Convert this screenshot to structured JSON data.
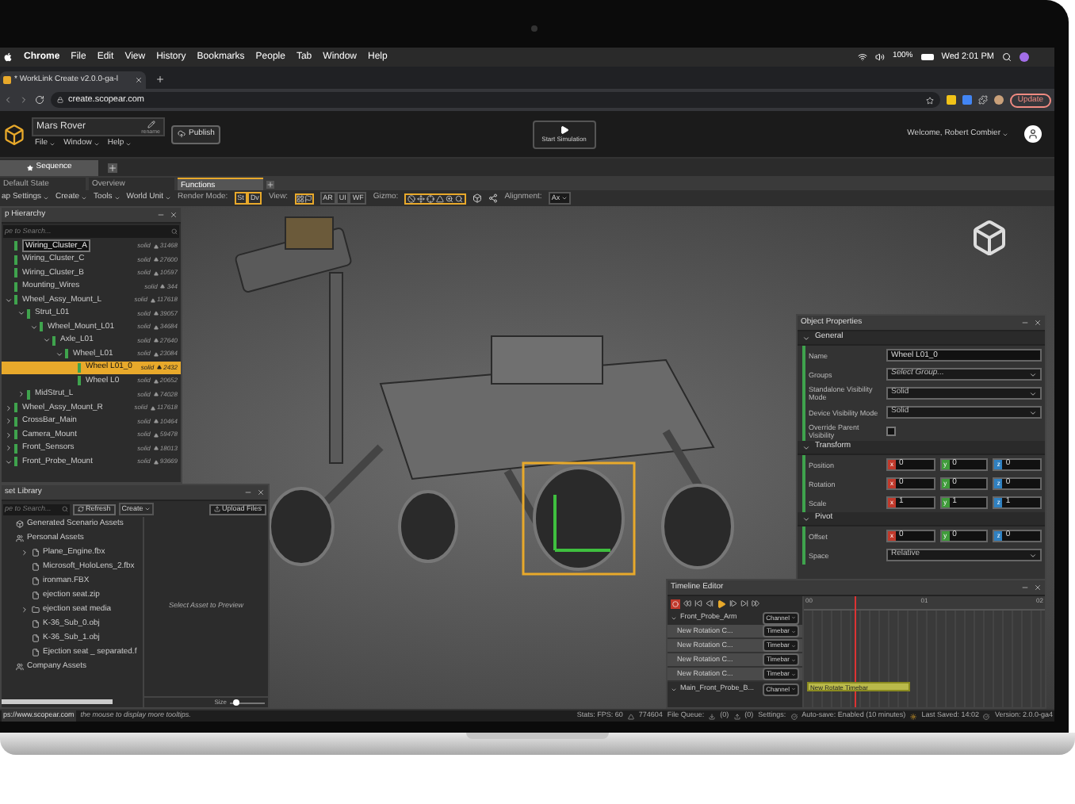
{
  "menu_bar": {
    "items": [
      "Chrome",
      "File",
      "Edit",
      "View",
      "History",
      "Bookmarks",
      "People",
      "Tab",
      "Window",
      "Help"
    ],
    "battery": "100%",
    "clock": "Wed 2:01 PM"
  },
  "browser": {
    "tab_title": "* WorkLink Create v2.0.0-ga-l",
    "url": "create.scopear.com",
    "update_button": "Update"
  },
  "app_header": {
    "project_name": "Mars Rover",
    "rename_label": "rename",
    "menus": [
      "File",
      "Window",
      "Help"
    ],
    "publish_button": "Publish",
    "simulation_button": "Start Simulation",
    "welcome": "Welcome, Robert Combier"
  },
  "sequence_tabs": [
    {
      "label": "Sequence",
      "selected": true
    }
  ],
  "state_tabs": [
    {
      "label": "Default State",
      "selected": false
    },
    {
      "label": "Overview",
      "selected": false
    },
    {
      "label": "Functions",
      "selected": true
    }
  ],
  "toolbar": {
    "menus": [
      "ap Settings",
      "Create",
      "Tools",
      "World Unit"
    ],
    "render_mode_label": "Render Mode:",
    "render_modes": [
      {
        "label": "St",
        "selected": true
      },
      {
        "label": "Dv",
        "selected": true
      }
    ],
    "view_label": "View:",
    "view_buttons": [
      "AR",
      "UI",
      "WF"
    ],
    "gizmo_label": "Gizmo:",
    "alignment_label": "Alignment:",
    "alignment_value": "Ax"
  },
  "hierarchy": {
    "title": "p Hierarchy",
    "search_placeholder": "pe to Search...",
    "nodes": [
      {
        "label": "Wiring_Cluster_A",
        "mode": "solid",
        "count": "31468",
        "selected": false,
        "renaming": true
      },
      {
        "label": "Wiring_Cluster_C",
        "mode": "solid",
        "count": "27600",
        "selected": false,
        "renaming": false
      },
      {
        "label": "Wiring_Cluster_B",
        "mode": "solid",
        "count": "10597",
        "selected": false,
        "renaming": false
      },
      {
        "label": "Mounting_Wires",
        "mode": "solid",
        "count": "344",
        "selected": false,
        "renaming": false
      },
      {
        "label": "Wheel_Assy_Mount_L",
        "mode": "solid",
        "count": "117618",
        "selected": false,
        "renaming": false,
        "expanded": true,
        "children": [
          {
            "label": "Strut_L01",
            "mode": "solid",
            "count": "39057",
            "selected": false,
            "renaming": false,
            "expanded": true,
            "children": [
              {
                "label": "Wheel_Mount_L01",
                "mode": "solid",
                "count": "34684",
                "selected": false,
                "renaming": false,
                "expanded": true,
                "children": [
                  {
                    "label": "Axle_L01",
                    "mode": "solid",
                    "count": "27640",
                    "selected": false,
                    "renaming": false,
                    "expanded": true,
                    "children": [
                      {
                        "label": "Wheel_L01",
                        "mode": "solid",
                        "count": "23084",
                        "selected": false,
                        "renaming": false,
                        "expanded": true,
                        "children": [
                          {
                            "label": "Wheel L01_0",
                            "mode": "solid",
                            "count": "2432",
                            "selected": true,
                            "renaming": false
                          },
                          {
                            "label": "Wheel L0",
                            "mode": "solid",
                            "count": "20652",
                            "selected": false,
                            "renaming": false
                          }
                        ]
                      }
                    ]
                  }
                ]
              }
            ]
          },
          {
            "label": "MidStrut_L",
            "mode": "solid",
            "count": "74028",
            "selected": false,
            "renaming": false,
            "expanded": false
          }
        ]
      },
      {
        "label": "Wheel_Assy_Mount_R",
        "mode": "solid",
        "count": "117618",
        "selected": false,
        "renaming": false,
        "expanded": false
      },
      {
        "label": "CrossBar_Main",
        "mode": "solid",
        "count": "10464",
        "selected": false,
        "renaming": false,
        "expanded": false
      },
      {
        "label": "Camera_Mount",
        "mode": "solid",
        "count": "59478",
        "selected": false,
        "renaming": false,
        "expanded": false
      },
      {
        "label": "Front_Sensors",
        "mode": "solid",
        "count": "18013",
        "selected": false,
        "renaming": false,
        "expanded": false
      },
      {
        "label": "Front_Probe_Mount",
        "mode": "solid",
        "count": "93669",
        "selected": false,
        "renaming": false,
        "expanded": true
      }
    ]
  },
  "asset_library": {
    "title": "set Library",
    "search_placeholder": "pe to Search...",
    "refresh_button": "Refresh",
    "create_menu": "Create",
    "upload_button": "Upload Files",
    "preview_text": "Select Asset to Preview",
    "size_label": "Size",
    "size_slider": {
      "level": 0.1
    },
    "items": [
      {
        "label": "Generated Scenario Assets",
        "kind": "group"
      },
      {
        "label": "Personal Assets",
        "kind": "person",
        "children": [
          {
            "label": "Plane_Engine.fbx",
            "kind": "file",
            "expanded": false
          },
          {
            "label": "Microsoft_HoloLens_2.fbx",
            "kind": "file"
          },
          {
            "label": "ironman.FBX",
            "kind": "file"
          },
          {
            "label": "ejection seat.zip",
            "kind": "file"
          },
          {
            "label": "ejection seat media",
            "kind": "folder",
            "expanded": false
          },
          {
            "label": "K-36_Sub_0.obj",
            "kind": "file"
          },
          {
            "label": "K-36_Sub_1.obj",
            "kind": "file"
          },
          {
            "label": "Ejection seat _ separated.f",
            "kind": "file"
          }
        ]
      },
      {
        "label": "Company Assets",
        "kind": "person"
      }
    ]
  },
  "object_properties": {
    "title": "Object Properties",
    "sections": [
      {
        "title": "General",
        "fields": [
          {
            "label": "Name",
            "kind": "text",
            "value": "Wheel L01_0"
          },
          {
            "label": "Groups",
            "kind": "select",
            "value": "Select Group...",
            "italic": true
          },
          {
            "label": "Standalone Visibility Mode",
            "kind": "select",
            "value": "Solid",
            "italic": false
          },
          {
            "label": "Device Visibility Mode",
            "kind": "select",
            "value": "Solid",
            "italic": false
          },
          {
            "label": "Override Parent Visibility",
            "kind": "checkbox",
            "checked": false
          }
        ]
      },
      {
        "title": "Transform",
        "fields": [
          {
            "label": "Position",
            "kind": "vector",
            "components": [
              {
                "axis": "x",
                "value": "0",
                "color": "#c0392b"
              },
              {
                "axis": "y",
                "value": "0",
                "color": "#3f9a3a"
              },
              {
                "axis": "z",
                "value": "0",
                "color": "#2f80c0"
              }
            ]
          },
          {
            "label": "Rotation",
            "kind": "vector",
            "components": [
              {
                "axis": "x",
                "value": "0",
                "color": "#c0392b"
              },
              {
                "axis": "y",
                "value": "0",
                "color": "#3f9a3a"
              },
              {
                "axis": "z",
                "value": "0",
                "color": "#2f80c0"
              }
            ]
          },
          {
            "label": "Scale",
            "kind": "vector",
            "components": [
              {
                "axis": "x",
                "value": "1",
                "color": "#c0392b"
              },
              {
                "axis": "y",
                "value": "1",
                "color": "#3f9a3a"
              },
              {
                "axis": "z",
                "value": "1",
                "color": "#2f80c0"
              }
            ]
          }
        ]
      },
      {
        "title": "Pivot",
        "fields": [
          {
            "label": "Offset",
            "kind": "vector",
            "components": [
              {
                "axis": "x",
                "value": "0",
                "color": "#c0392b"
              },
              {
                "axis": "y",
                "value": "0",
                "color": "#3f9a3a"
              },
              {
                "axis": "z",
                "value": "0",
                "color": "#2f80c0"
              }
            ]
          },
          {
            "label": "Space",
            "kind": "select",
            "value": "Relative",
            "italic": false
          }
        ]
      }
    ]
  },
  "timeline": {
    "title": "Timeline Editor",
    "ruler_labels": [
      "00",
      "01",
      "02"
    ],
    "clip": "New Rotate Timebar",
    "tracks": [
      {
        "label": "Front_Probe_Arm",
        "kind": "group",
        "dropdown": "Channel"
      },
      {
        "label": "New Rotation C...",
        "kind": "item",
        "dropdown": "Timebar"
      },
      {
        "label": "New Rotation C...",
        "kind": "item",
        "dropdown": "Timebar"
      },
      {
        "label": "New Rotation C...",
        "kind": "item",
        "dropdown": "Timebar"
      },
      {
        "label": "New Rotation C...",
        "kind": "item",
        "dropdown": "Timebar"
      },
      {
        "label": "Main_Front_Probe_B...",
        "kind": "group",
        "dropdown": "Channel"
      }
    ]
  },
  "status_bar": {
    "url": "ps://www.scopear.com",
    "hint": "the mouse to display more tooltips.",
    "stats": "Stats:  FPS: 60",
    "triangles": "774604",
    "queue_label": "File Queue:",
    "downloads": "(0)",
    "uploads": "(0)",
    "settings": "Settings:",
    "autosave": "Auto-save: Enabled (10 minutes)",
    "last_saved": "Last Saved: 14:02",
    "version": "Version: 2.0.0-ga4"
  }
}
